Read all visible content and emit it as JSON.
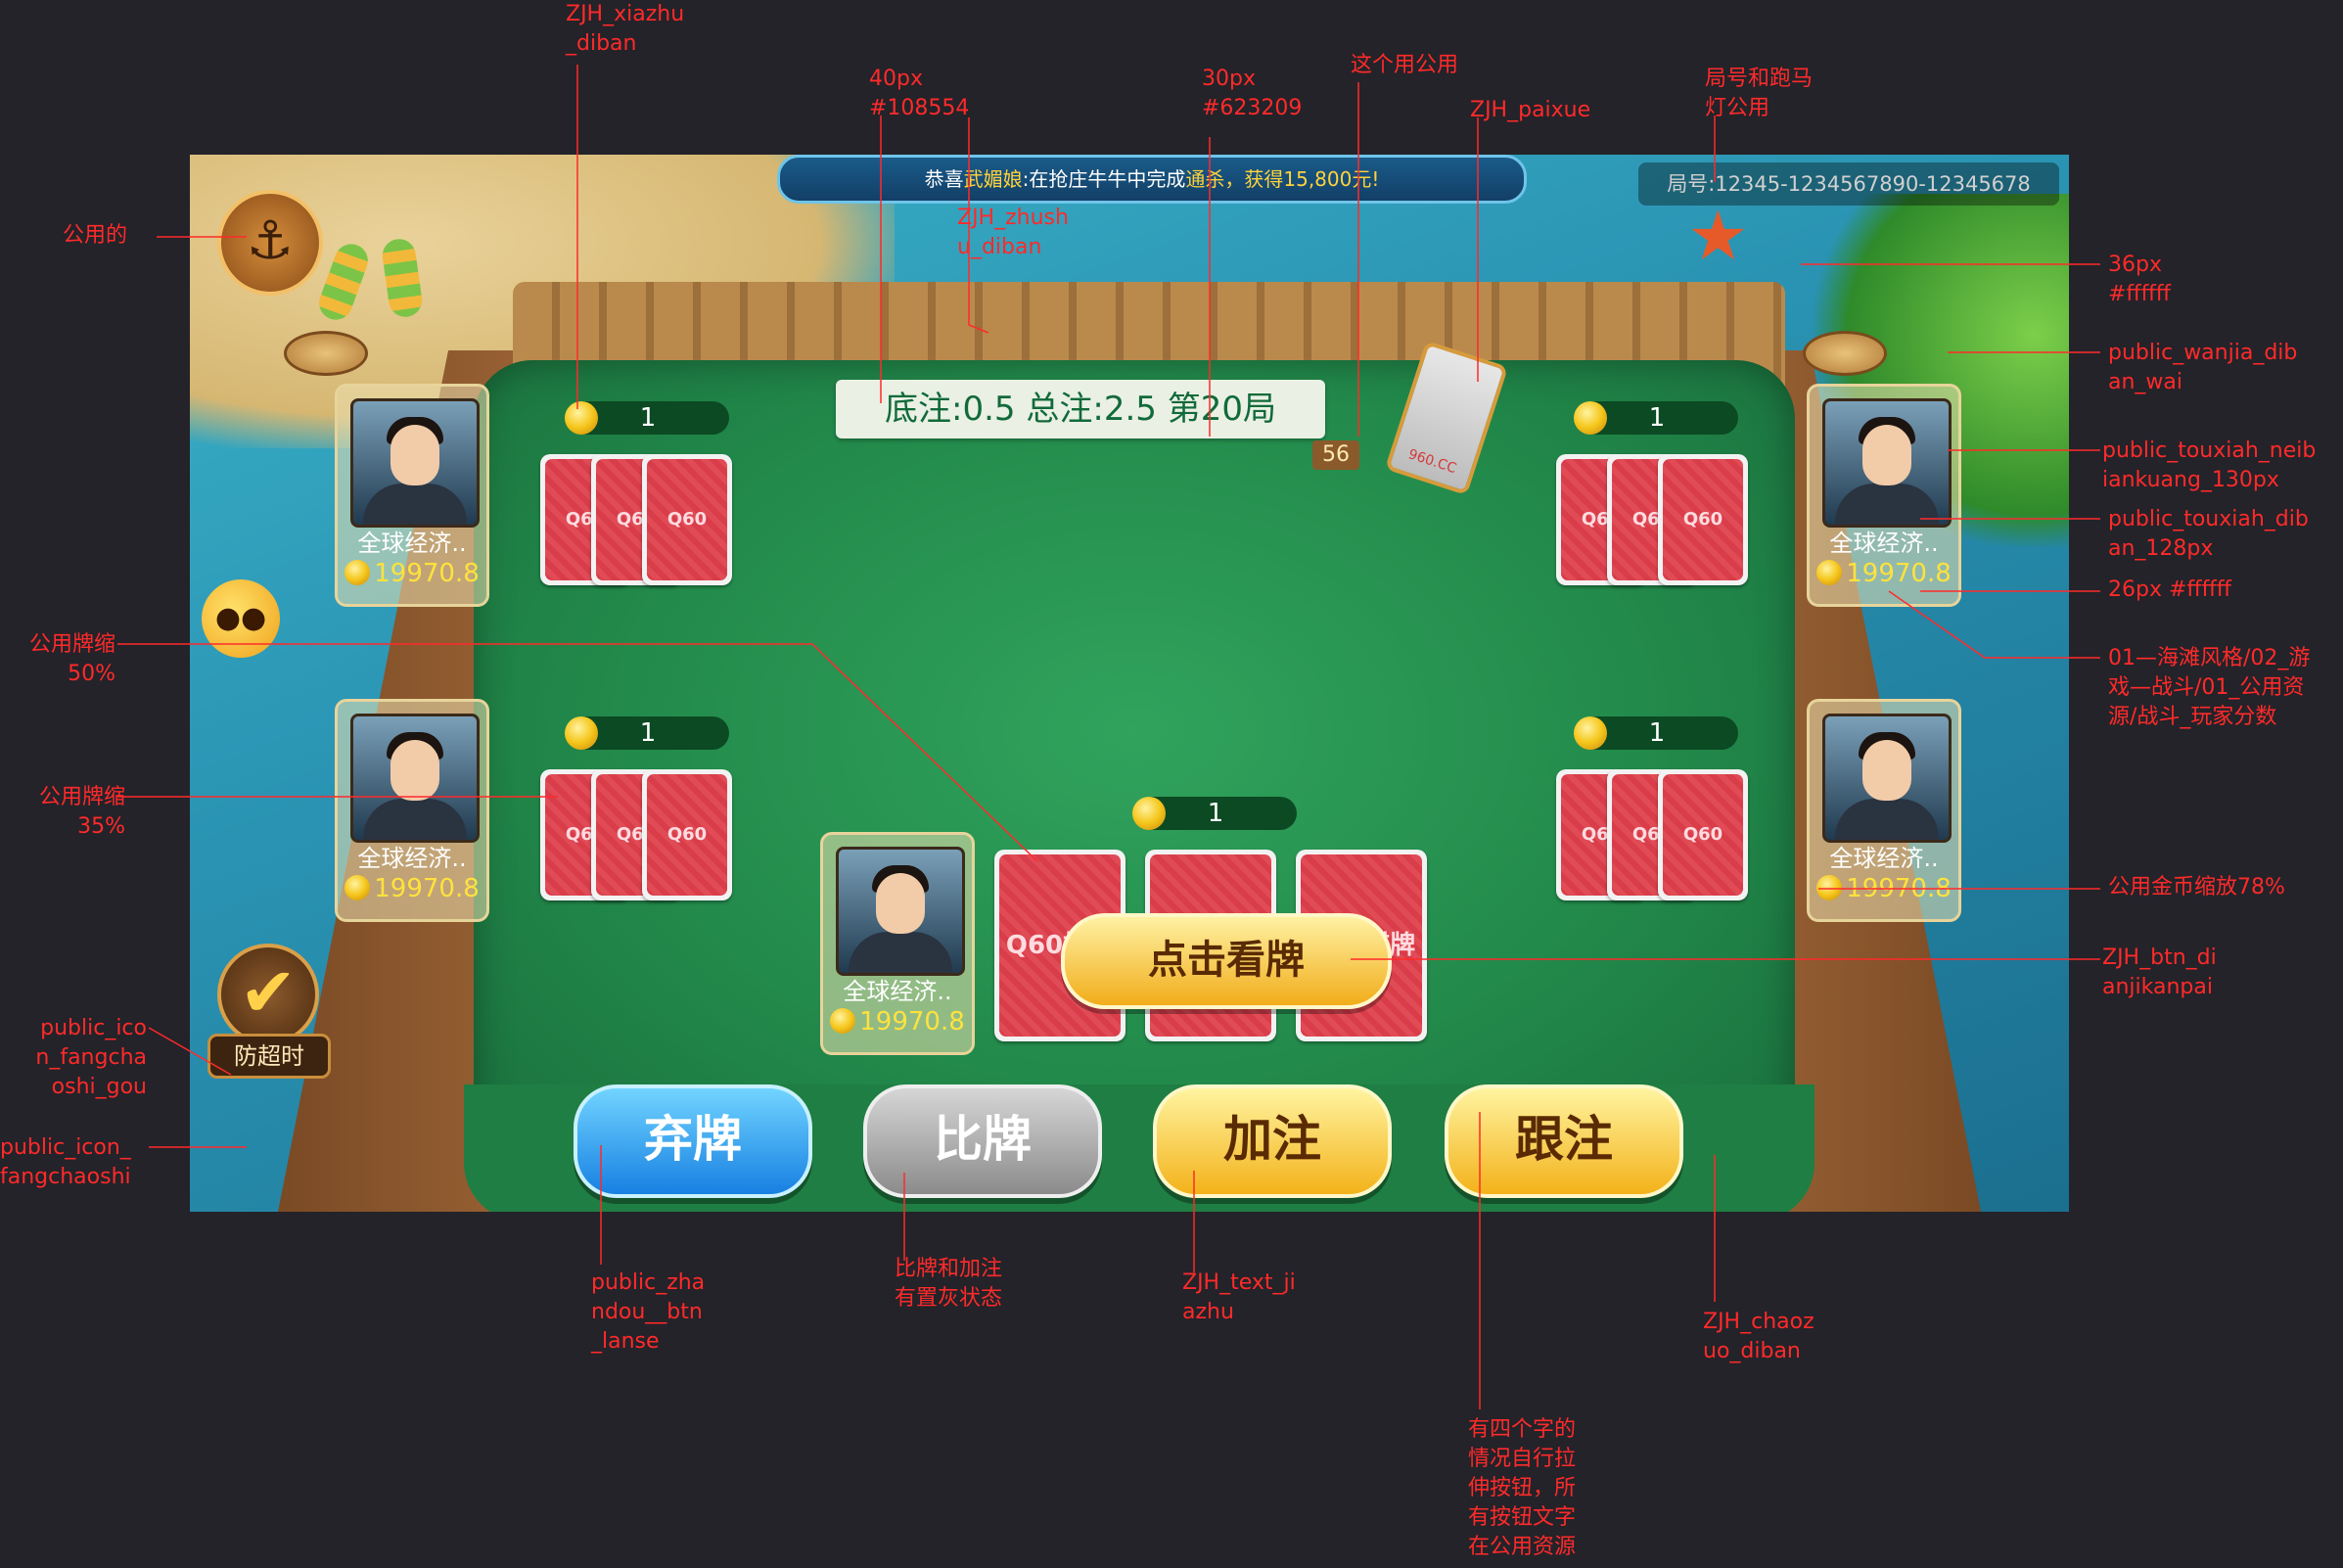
{
  "banner": {
    "prefix": "恭喜",
    "name": "武媚娘",
    "mid": ":在抢庄牛牛中完成",
    "word": "通杀",
    "suffix": "，获得15,800元!"
  },
  "ju": {
    "label": "局号",
    "value": ":12345-1234567890-12345678"
  },
  "pot": {
    "text": "底注:0.5   总注:2.5  第20局"
  },
  "shoe_count": "56",
  "shoe_label": "960.CC",
  "card_back_text": "Q60",
  "card_back_text_big": "Q60棋牌",
  "players": [
    {
      "name": "全球经济..",
      "score": "19970.8",
      "bet": "1"
    },
    {
      "name": "全球经济..",
      "score": "19970.8",
      "bet": "1"
    },
    {
      "name": "全球经济..",
      "score": "19970.8",
      "bet": "1"
    },
    {
      "name": "全球经济..",
      "score": "19970.8",
      "bet": "1"
    },
    {
      "name": "全球经济..",
      "score": "19970.8",
      "bet": "1"
    }
  ],
  "buttons": {
    "qipai": "弃牌",
    "bipai": "比牌",
    "jiazhu": "加注",
    "genzhu": "跟注",
    "kanpai": "点击看牌",
    "fangchao": "防超时"
  },
  "icons": {
    "anchor": "anchor-icon",
    "check": "checkmark-icon",
    "coin": "coin-icon",
    "fish": "pufferfish-icon",
    "starfish": "starfish-icon"
  },
  "annotations": {
    "xiazhu": "ZJH_xiazhu\n_diban",
    "px40": "40px\n#108554",
    "px30": "30px\n#623209",
    "zhege": "这个用公用",
    "paixue": "ZJH_paixue",
    "juhao": "局号和跑马\n灯公用",
    "gongyong": "公用的",
    "zhushu": "ZJH_zhush\nu_diban",
    "px36": "36px\n#ffffff",
    "wanjia": "public_wanjia_dib\nan_wai",
    "neibian": "public_touxiah_neib\niankuang_130px",
    "dibian": "public_touxiah_dib\nan_128px",
    "px26": "26px #ffffff",
    "fenshu": "01—海滩风格/02_游\n戏—战斗/01_公用资\n源/战斗_玩家分数",
    "suo50": "公用牌缩\n50%",
    "suo35": "公用牌缩\n35%",
    "jinbi": "公用金币缩放78%",
    "kanpai": "ZJH_btn_di\nanjikanpai",
    "fcgou": "public_ico\nn_fangcha\noshi_gou",
    "fcicon": "public_icon_\nfangchaoshi",
    "lanse": "public_zha\nndou__btn\n_lanse",
    "zhihui": "比牌和加注\n有置灰状态",
    "jiazhu": "ZJH_text_ji\nazhu",
    "chaozuo": "ZJH_chaoz\nuo_diban",
    "sizi": "有四个字的\n情况自行拉\n伸按钮，所\n有按钮文字\n在公用资源"
  }
}
